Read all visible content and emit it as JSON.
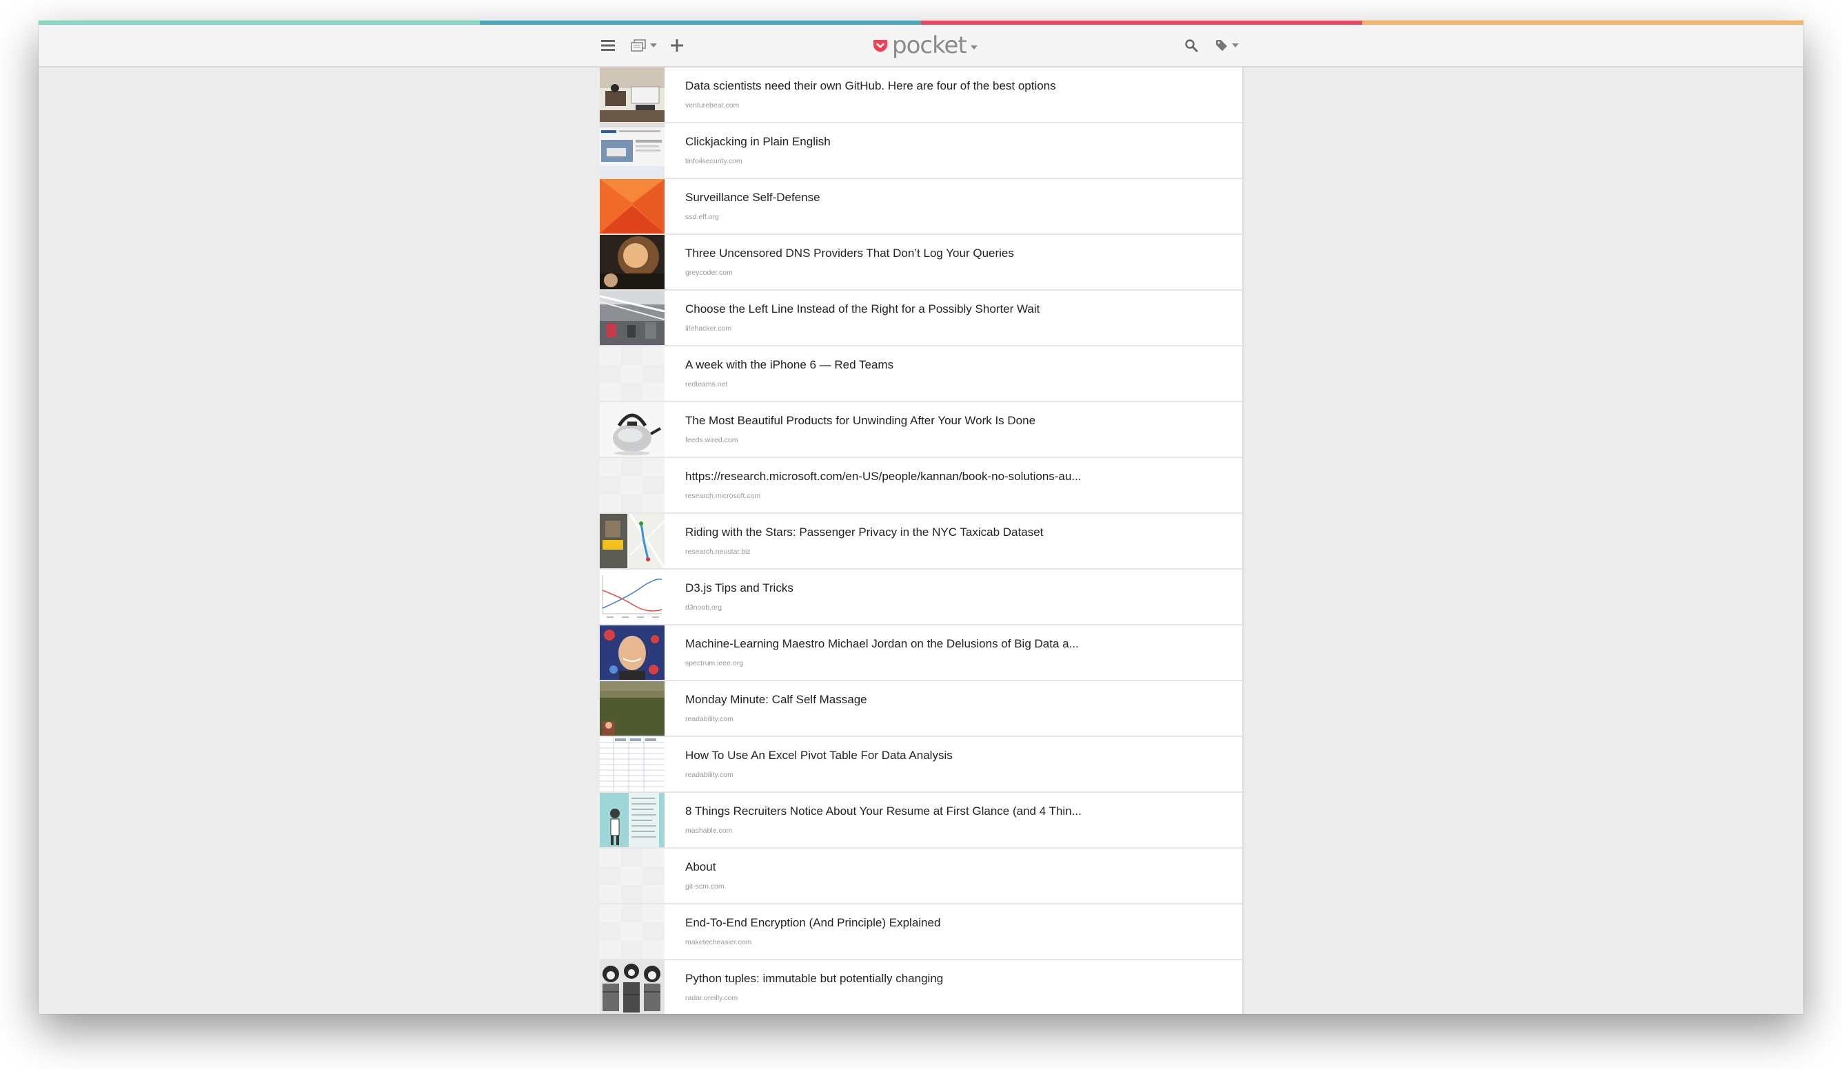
{
  "window": {
    "stripe_colors": [
      "#88d6c4",
      "#4aa9b8",
      "#e84860",
      "#f5b66b"
    ]
  },
  "header": {
    "menu_icon": "hamburger-menu-icon",
    "view_icon": "list-view-icon",
    "add_icon": "plus-icon",
    "search_icon": "search-icon",
    "tag_icon": "tag-icon",
    "logo_text": "pocket",
    "logo_color": "#ef4056"
  },
  "items": [
    {
      "title": "Data scientists need their own GitHub. Here are four of the best options",
      "domain": "venturebeat.com",
      "thumb": "office-photo"
    },
    {
      "title": "Clickjacking in Plain English",
      "domain": "tinfoilsecurity.com",
      "thumb": "website-screenshot"
    },
    {
      "title": "Surveillance Self-Defense",
      "domain": "ssd.eff.org",
      "thumb": "orange-graphic"
    },
    {
      "title": "Three Uncensored DNS Providers That Don’t Log Your Queries",
      "domain": "greycoder.com",
      "thumb": "dark-portrait"
    },
    {
      "title": "Choose the Left Line Instead of the Right for a Possibly Shorter Wait",
      "domain": "lifehacker.com",
      "thumb": "store-checkout-photo"
    },
    {
      "title": "A week with the iPhone 6 — Red Teams",
      "domain": "redteams.net",
      "thumb": "placeholder"
    },
    {
      "title": "The Most Beautiful Products for Unwinding After Your Work Is Done",
      "domain": "feeds.wired.com",
      "thumb": "kettle-photo"
    },
    {
      "title": "https://research.microsoft.com/en-US/people/kannan/book-no-solutions-au...",
      "domain": "research.microsoft.com",
      "thumb": "placeholder"
    },
    {
      "title": "Riding with the Stars: Passenger Privacy in the NYC Taxicab Dataset",
      "domain": "research.neustar.biz",
      "thumb": "taxi-map"
    },
    {
      "title": "D3.js Tips and Tricks",
      "domain": "d3noob.org",
      "thumb": "line-graph"
    },
    {
      "title": "Machine-Learning Maestro Michael Jordan on the Delusions of Big Data a...",
      "domain": "spectrum.ieee.org",
      "thumb": "man-portrait"
    },
    {
      "title": "Monday Minute: Calf Self Massage",
      "domain": "readability.com",
      "thumb": "field-photo"
    },
    {
      "title": "How To Use An Excel Pivot Table For Data Analysis",
      "domain": "readability.com",
      "thumb": "spreadsheet"
    },
    {
      "title": "8 Things Recruiters Notice About Your Resume at First Glance (and 4 Thin...",
      "domain": "mashable.com",
      "thumb": "resume-illustration"
    },
    {
      "title": "About",
      "domain": "git-scm.com",
      "thumb": "placeholder"
    },
    {
      "title": "End-To-End Encryption (And Principle) Explained",
      "domain": "maketecheasier.com",
      "thumb": "placeholder"
    },
    {
      "title": "Python tuples: immutable but potentially changing",
      "domain": "radar.oreilly.com",
      "thumb": "engraving"
    }
  ]
}
